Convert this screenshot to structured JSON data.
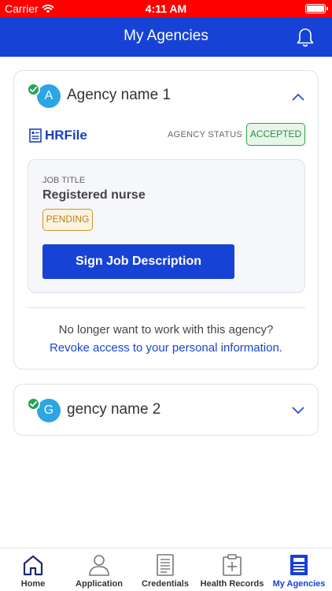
{
  "status_bar": {
    "carrier": "Carrier",
    "time": "4:11 AM"
  },
  "nav": {
    "title": "My Agencies"
  },
  "agencies": [
    {
      "avatar_letter": "A",
      "name": "Agency name 1",
      "brand": "HRFile",
      "status_label": "AGENCY STATUS",
      "status": "ACCEPTED",
      "job": {
        "label": "JOB TITLE",
        "title": "Registered nurse",
        "status": "PENDING",
        "action_label": "Sign Job Description"
      },
      "revoke_question": "No longer want to work with this agency?",
      "revoke_link": "Revoke access to your personal information."
    },
    {
      "avatar_letter": "G",
      "name": "gency name 2"
    }
  ],
  "tabs": [
    {
      "label": "Home",
      "icon": "home-icon",
      "active": false
    },
    {
      "label": "Application",
      "icon": "person-icon",
      "active": false
    },
    {
      "label": "Credentials",
      "icon": "document-icon",
      "active": false
    },
    {
      "label": "Health Records",
      "icon": "clipboard-plus-icon",
      "active": false
    },
    {
      "label": "My Agencies",
      "icon": "newspaper-icon",
      "active": true
    }
  ],
  "colors": {
    "status_bar": "#ff0000",
    "primary": "#1742d6",
    "accepted": "#2aa34f",
    "pending": "#c9952a",
    "avatar": "#2ba5e3"
  }
}
